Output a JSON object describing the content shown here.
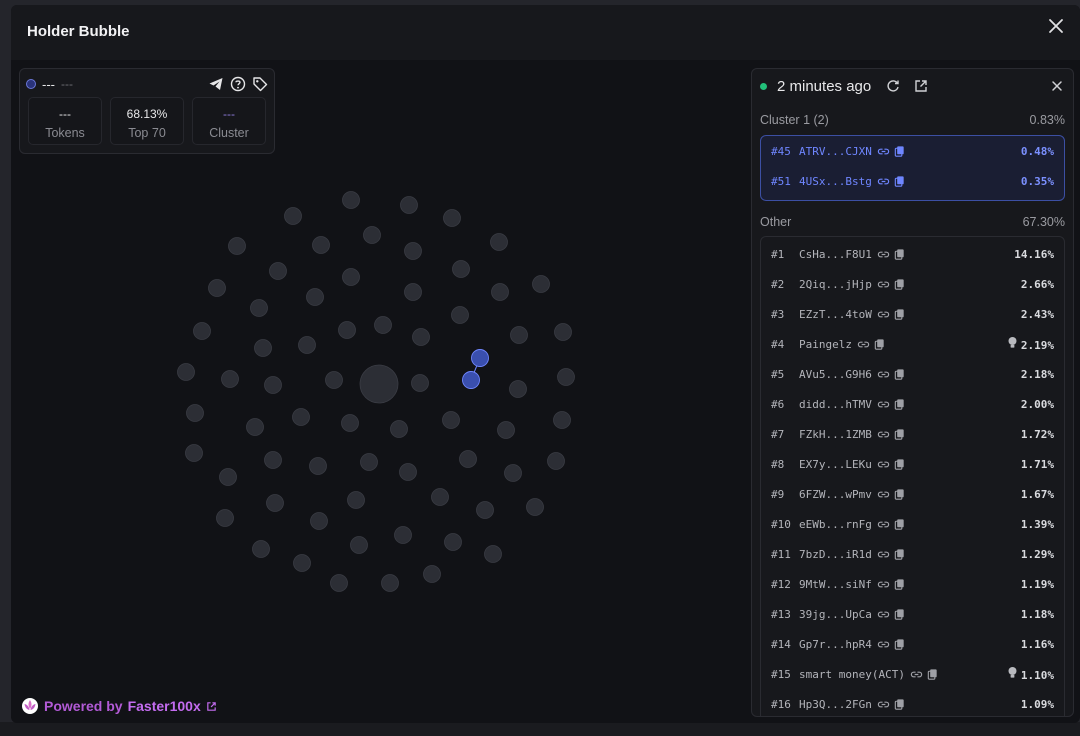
{
  "modal": {
    "title": "Holder Bubble"
  },
  "info": {
    "name": "---",
    "sub": "---",
    "stats": [
      {
        "value": "---",
        "label": "Tokens"
      },
      {
        "value": "68.13%",
        "label": "Top 70"
      },
      {
        "value": "---",
        "label": "Cluster"
      }
    ]
  },
  "powered": {
    "prefix": "Powered by",
    "brand": "Faster100x"
  },
  "panel": {
    "time": "2 minutes ago",
    "cluster": {
      "label": "Cluster 1 (2)",
      "pct": "0.83%",
      "rows": [
        {
          "rank": "#45",
          "addr": "ATRV...CJXN",
          "pct": "0.48%"
        },
        {
          "rank": "#51",
          "addr": "4USx...Bstg",
          "pct": "0.35%"
        }
      ]
    },
    "other": {
      "label": "Other",
      "pct": "67.30%",
      "rows": [
        {
          "rank": "#1",
          "addr": "CsHa...F8U1",
          "pct": "14.16%",
          "bulb": false
        },
        {
          "rank": "#2",
          "addr": "2Qiq...jHjp",
          "pct": "2.66%",
          "bulb": false
        },
        {
          "rank": "#3",
          "addr": "EZzT...4toW",
          "pct": "2.43%",
          "bulb": false
        },
        {
          "rank": "#4",
          "addr": "Paingelz",
          "pct": "2.19%",
          "bulb": true
        },
        {
          "rank": "#5",
          "addr": "AVu5...G9H6",
          "pct": "2.18%",
          "bulb": false
        },
        {
          "rank": "#6",
          "addr": "didd...hTMV",
          "pct": "2.00%",
          "bulb": false
        },
        {
          "rank": "#7",
          "addr": "FZkH...1ZMB",
          "pct": "1.72%",
          "bulb": false
        },
        {
          "rank": "#8",
          "addr": "EX7y...LEKu",
          "pct": "1.71%",
          "bulb": false
        },
        {
          "rank": "#9",
          "addr": "6FZW...wPmv",
          "pct": "1.67%",
          "bulb": false
        },
        {
          "rank": "#10",
          "addr": "eEWb...rnFg",
          "pct": "1.39%",
          "bulb": false
        },
        {
          "rank": "#11",
          "addr": "7bzD...iR1d",
          "pct": "1.29%",
          "bulb": false
        },
        {
          "rank": "#12",
          "addr": "9MtW...siNf",
          "pct": "1.19%",
          "bulb": false
        },
        {
          "rank": "#13",
          "addr": "39jg...UpCa",
          "pct": "1.18%",
          "bulb": false
        },
        {
          "rank": "#14",
          "addr": "Gp7r...hpR4",
          "pct": "1.16%",
          "bulb": false
        },
        {
          "rank": "#15",
          "addr": "smart money(ACT)",
          "pct": "1.10%",
          "bulb": true
        },
        {
          "rank": "#16",
          "addr": "Hp3Q...2FGn",
          "pct": "1.09%",
          "bulb": false
        }
      ]
    }
  },
  "colors": {
    "accent_blue": "#6f86ff",
    "bubble": "#2c2e35",
    "cluster_bubble": "#3a4fae",
    "live": "#22c07a",
    "brand": "#c46cf0"
  }
}
